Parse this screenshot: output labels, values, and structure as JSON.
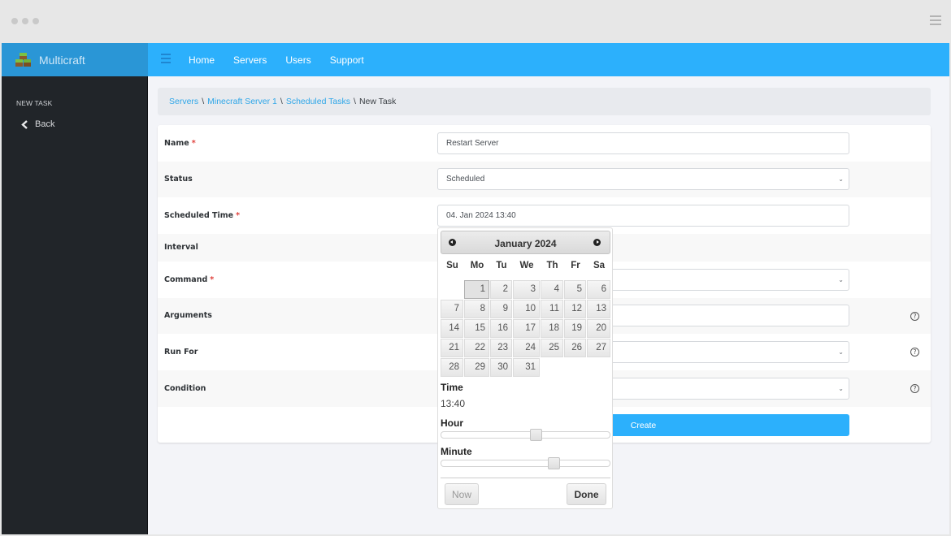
{
  "window": {
    "controls": [
      "dot",
      "dot",
      "dot"
    ],
    "menu_icon": "hamburger-icon"
  },
  "brand": {
    "name": "Multicraft",
    "logo_icon": "grass-blocks-icon"
  },
  "topnav": {
    "toggle_icon": "hamburger-icon",
    "links": [
      "Home",
      "Servers",
      "Users",
      "Support"
    ]
  },
  "sidebar": {
    "section_title": "NEW TASK",
    "back_label": "Back",
    "back_icon": "chevron-left-icon"
  },
  "breadcrumb": {
    "items": [
      "Servers",
      "Minecraft Server 1",
      "Scheduled Tasks"
    ],
    "current": "New Task",
    "separator": "\\"
  },
  "form": {
    "fields": [
      {
        "label": "Name",
        "required": true,
        "type": "text",
        "value": "Restart Server"
      },
      {
        "label": "Status",
        "required": false,
        "type": "select",
        "value": "Scheduled"
      },
      {
        "label": "Scheduled Time",
        "required": true,
        "type": "text",
        "value": "04. Jan 2024 13:40"
      },
      {
        "label": "Interval",
        "required": false,
        "type": "hidden-by-popup",
        "value": ""
      },
      {
        "label": "Command",
        "required": true,
        "type": "select",
        "value": ""
      },
      {
        "label": "Arguments",
        "required": false,
        "type": "text",
        "value": "",
        "help": true
      },
      {
        "label": "Run For",
        "required": false,
        "type": "select",
        "value": "",
        "help": true
      },
      {
        "label": "Condition",
        "required": false,
        "type": "select",
        "value": "",
        "help": true
      }
    ],
    "required_marker": "*",
    "help_glyph": "?",
    "submit_label": "Create"
  },
  "datepicker": {
    "month_title": "January 2024",
    "prev_icon": "circle-arrow-left-icon",
    "next_icon": "circle-arrow-right-icon",
    "weekdays": [
      "Su",
      "Mo",
      "Tu",
      "We",
      "Th",
      "Fr",
      "Sa"
    ],
    "leading_blanks": 1,
    "days": [
      "1",
      "2",
      "3",
      "4",
      "5",
      "6",
      "7",
      "8",
      "9",
      "10",
      "11",
      "12",
      "13",
      "14",
      "15",
      "16",
      "17",
      "18",
      "19",
      "20",
      "21",
      "22",
      "23",
      "24",
      "25",
      "26",
      "27",
      "28",
      "29",
      "30",
      "31"
    ],
    "highlighted_day": "1",
    "time_label": "Time",
    "time_value": "13:40",
    "hour_label": "Hour",
    "hour_value": 13,
    "hour_max": 23,
    "minute_label": "Minute",
    "minute_value": 40,
    "minute_max": 59,
    "now_label": "Now",
    "done_label": "Done"
  }
}
